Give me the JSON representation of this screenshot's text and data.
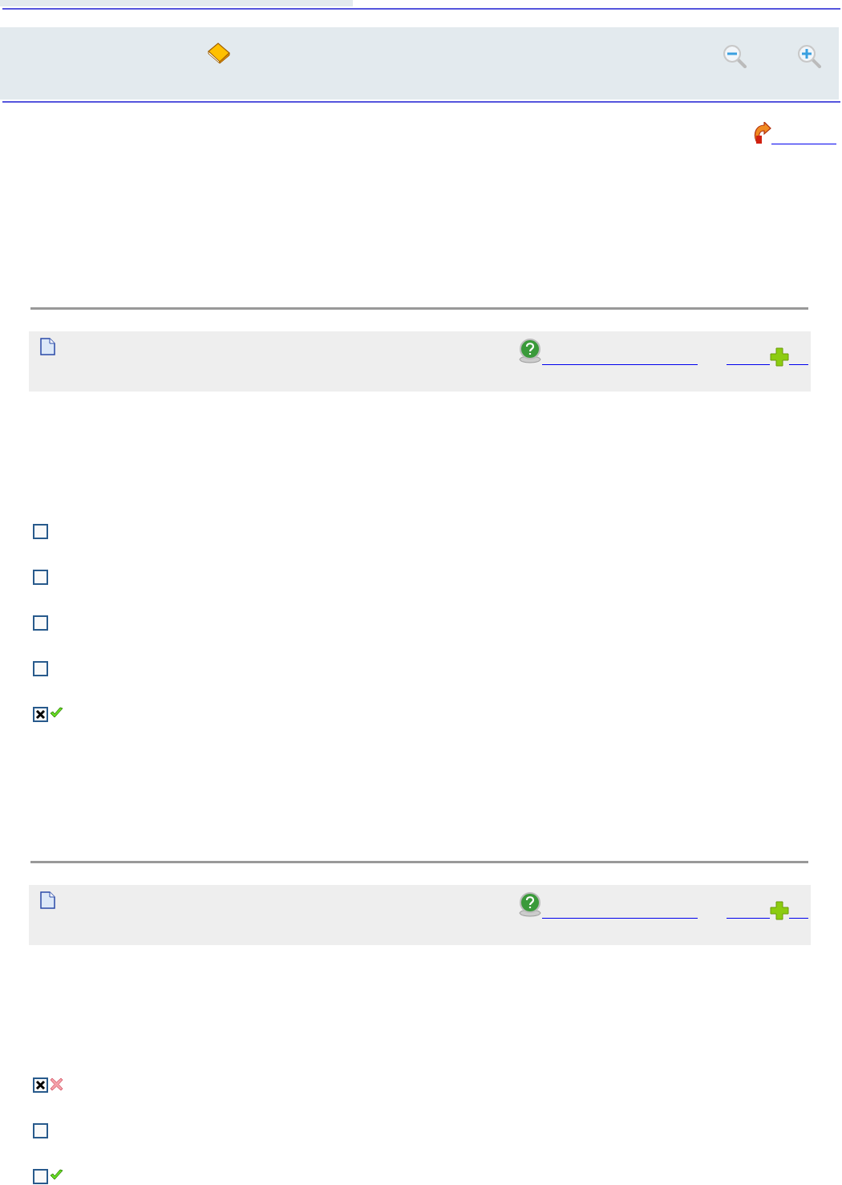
{
  "questions": [
    {
      "options": [
        {
          "kind": "plain",
          "checked": false
        },
        {
          "kind": "plain",
          "checked": false
        },
        {
          "kind": "plain",
          "checked": false
        },
        {
          "kind": "plain",
          "checked": false
        },
        {
          "kind": "correct",
          "checked": true
        }
      ]
    },
    {
      "options": [
        {
          "kind": "wrong",
          "checked": true
        },
        {
          "kind": "plain",
          "checked": false
        },
        {
          "kind": "correct",
          "checked": false
        }
      ]
    }
  ]
}
